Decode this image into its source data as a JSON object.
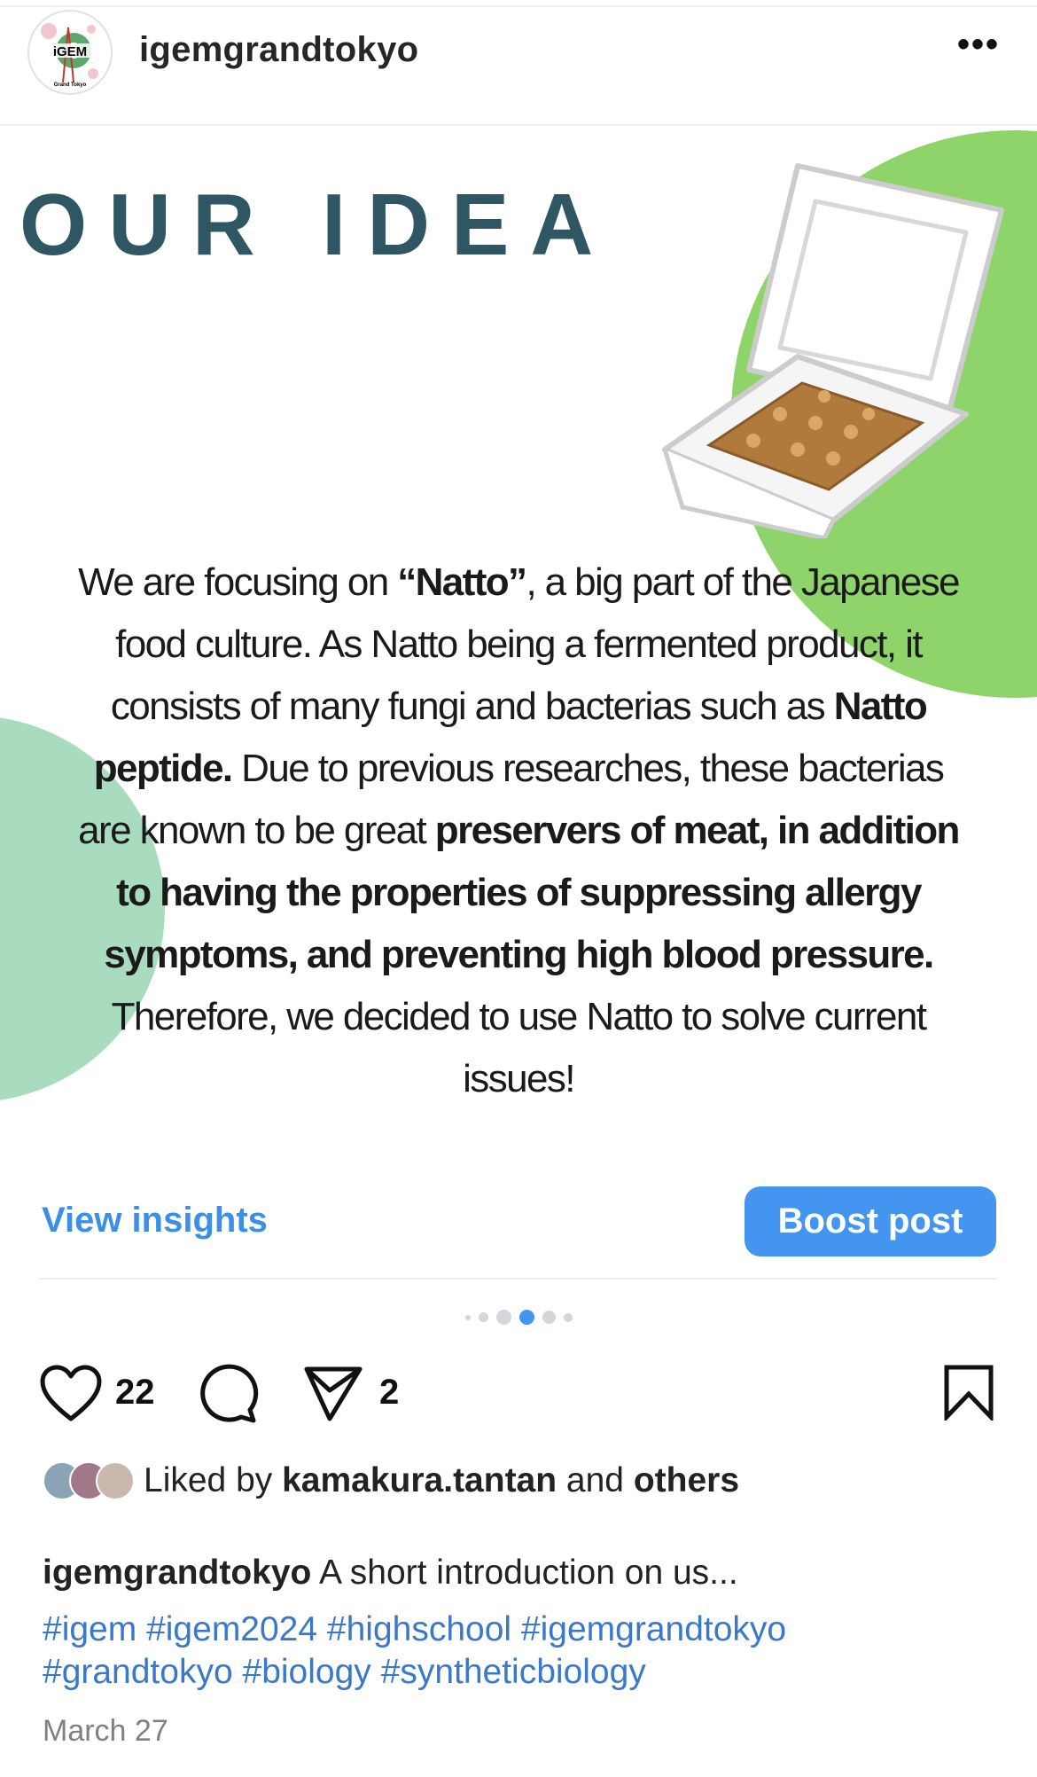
{
  "header": {
    "username": "igemgrandtokyo",
    "avatar_logo_text": "iGEM Grand Tokyo",
    "more_icon": "more-horizontal-icon"
  },
  "image": {
    "title": "OUR IDEA",
    "lines": [
      [
        {
          "t": "We are focusing on ",
          "b": false
        },
        {
          "t": "“Natto”",
          "b": true
        },
        {
          "t": ", a big part of the Japanese",
          "b": false
        }
      ],
      [
        {
          "t": "food culture. As Natto being a fermented product, it",
          "b": false
        }
      ],
      [
        {
          "t": "consists of many fungi and bacterias such as ",
          "b": false
        },
        {
          "t": "Natto",
          "b": true
        }
      ],
      [
        {
          "t": "peptide.",
          "b": true
        },
        {
          "t": " Due to previous researches, these bacterias",
          "b": false
        }
      ],
      [
        {
          "t": "are known to be great ",
          "b": false
        },
        {
          "t": "preservers of meat, in addition",
          "b": true
        }
      ],
      [
        {
          "t": "to having the properties of suppressing allergy",
          "b": true
        }
      ],
      [
        {
          "t": "symptoms, and preventing high blood pressure.",
          "b": true
        }
      ],
      [
        {
          "t": "Therefore, we decided to use Natto to solve current",
          "b": false
        }
      ],
      [
        {
          "t": "issues!",
          "b": false
        }
      ]
    ],
    "colors": {
      "green": "#8fd46a",
      "mint": "#a9dcbf",
      "title": "#2f5663"
    }
  },
  "actions": {
    "view_insights": "View insights",
    "boost_post": "Boost post",
    "likes": "22",
    "shares": "2",
    "accent": "#4395f0"
  },
  "carousel": {
    "count": 6,
    "active": 3
  },
  "liked_by": {
    "prefix": "Liked by ",
    "user": "kamakura.tantan",
    "mid": " and ",
    "others": "others"
  },
  "caption": {
    "user": "igemgrandtokyo",
    "text": " A short introduction on us..."
  },
  "hashtags": {
    "line1": [
      "#igem",
      "#igem2024",
      "#highschool",
      "#igemgrandtokyo"
    ],
    "line2": [
      "#grandtokyo",
      "#biology",
      "#syntheticbiology"
    ]
  },
  "date": "March 27"
}
